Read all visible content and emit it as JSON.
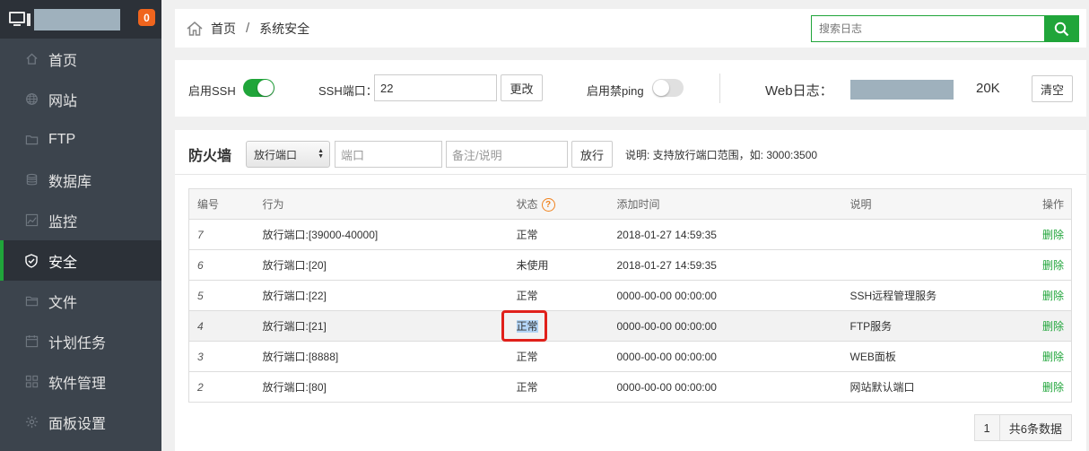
{
  "sidebar": {
    "notification_count": "0",
    "items": [
      {
        "label": "首页",
        "icon": "home-icon"
      },
      {
        "label": "网站",
        "icon": "globe-icon"
      },
      {
        "label": "FTP",
        "icon": "ftp-folder-icon"
      },
      {
        "label": "数据库",
        "icon": "database-icon"
      },
      {
        "label": "监控",
        "icon": "monitor-chart-icon"
      },
      {
        "label": "安全",
        "icon": "shield-icon"
      },
      {
        "label": "文件",
        "icon": "folder-icon"
      },
      {
        "label": "计划任务",
        "icon": "calendar-icon"
      },
      {
        "label": "软件管理",
        "icon": "grid-icon"
      },
      {
        "label": "面板设置",
        "icon": "gear-icon"
      }
    ],
    "active_index": 5
  },
  "breadcrumb": {
    "home": "首页",
    "separator": "/",
    "current": "系统安全"
  },
  "search": {
    "placeholder": "搜索日志"
  },
  "settings": {
    "ssh_label": "启用SSH",
    "ssh_enabled": true,
    "ssh_port_label": "SSH端口：",
    "ssh_port_value": "22",
    "change_button": "更改",
    "ping_label": "启用禁ping",
    "ping_enabled": false,
    "web_log_label": "Web日志：",
    "web_log_size": "20K",
    "clear_button": "清空"
  },
  "firewall": {
    "title": "防火墙",
    "type_selected": "放行端口",
    "port_placeholder": "端口",
    "remark_placeholder": "备注/说明",
    "allow_button": "放行",
    "note": "说明: 支持放行端口范围，如: 3000:3500",
    "columns": {
      "id": "编号",
      "action": "行为",
      "status": "状态",
      "added": "添加时间",
      "remark": "说明",
      "operation": "操作"
    },
    "rows": [
      {
        "id": "7",
        "action": "放行端口:[39000-40000]",
        "status": "正常",
        "added": "2018-01-27 14:59:35",
        "remark": "",
        "op": "删除"
      },
      {
        "id": "6",
        "action": "放行端口:[20]",
        "status": "未使用",
        "added": "2018-01-27 14:59:35",
        "remark": "",
        "op": "删除"
      },
      {
        "id": "5",
        "action": "放行端口:[22]",
        "status": "正常",
        "added": "0000-00-00 00:00:00",
        "remark": "SSH远程管理服务",
        "op": "删除"
      },
      {
        "id": "4",
        "action": "放行端口:[21]",
        "status": "正常",
        "added": "0000-00-00 00:00:00",
        "remark": "FTP服务",
        "op": "删除"
      },
      {
        "id": "3",
        "action": "放行端口:[8888]",
        "status": "正常",
        "added": "0000-00-00 00:00:00",
        "remark": "WEB面板",
        "op": "删除"
      },
      {
        "id": "2",
        "action": "放行端口:[80]",
        "status": "正常",
        "added": "0000-00-00 00:00:00",
        "remark": "网站默认端口",
        "op": "删除"
      }
    ],
    "pager": {
      "page": "1",
      "total": "共6条数据"
    }
  },
  "colors": {
    "accent": "#20a53a",
    "sidebar_bg": "#3c444d",
    "badge": "#f0651e",
    "highlight_box": "#e0201a"
  }
}
